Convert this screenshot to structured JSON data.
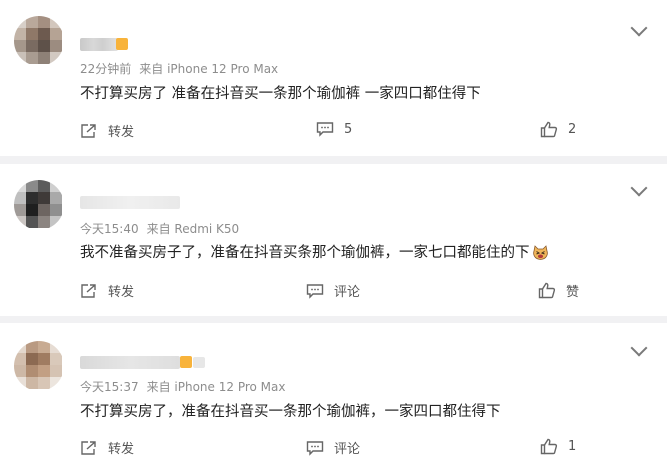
{
  "comments": [
    {
      "time": "22分钟前",
      "device": "来自 iPhone 12 Pro Max",
      "text": "不打算买房了 准备在抖音买一条那个瑜伽裤 一家四口都住得下",
      "repost_label": "转发",
      "comment_label": "5",
      "like_label": "2"
    },
    {
      "time": "今天15:40",
      "device": "来自 Redmi K50",
      "text": "我不准备买房子了，准备在抖音买条那个瑜伽裤，一家七口都能住的下",
      "emoji": "cat-emoji",
      "repost_label": "转发",
      "comment_label": "评论",
      "like_label": "赞"
    },
    {
      "time": "今天15:37",
      "device": "来自 iPhone 12 Pro Max",
      "text": "不打算买房了，准备在抖音买一条那个瑜伽裤，一家四口都住得下",
      "repost_label": "转发",
      "comment_label": "评论",
      "like_label": "1"
    }
  ],
  "icons": {
    "repost": "share-icon",
    "comment": "comment-icon",
    "like": "thumbs-up-icon",
    "expand": "chevron-down-icon"
  },
  "colors": {
    "background": "#f1f1f3",
    "card": "#ffffff",
    "meta_text": "#8d8d8d",
    "vip_badge": "#f8b33b"
  }
}
